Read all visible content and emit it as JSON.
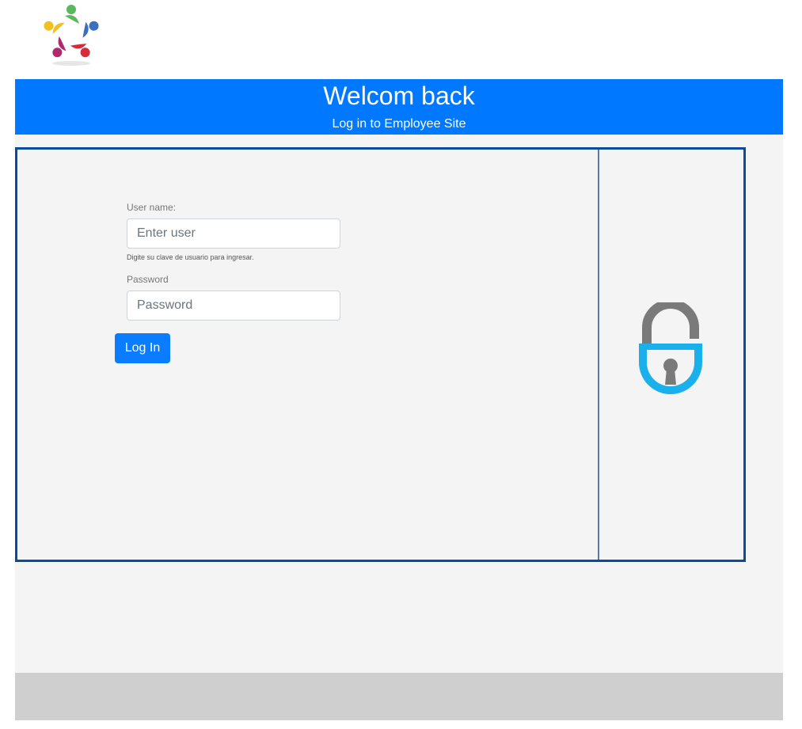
{
  "header": {
    "title": "Welcom back",
    "subtitle": "Log in to Employee Site",
    "logo_icon": "team-circle-logo-icon",
    "banner_color": "#0078ff"
  },
  "login_form": {
    "username_label": "User name:",
    "username_placeholder": "Enter user",
    "username_value": "",
    "username_help": "Digite su clave de usuario para ingresar.",
    "password_label": "Password",
    "password_placeholder": "Password",
    "password_value": "",
    "submit_label": "Log In",
    "button_color": "#0a7cff",
    "border_color": "#0a4c9a"
  },
  "side_panel": {
    "icon": "open-padlock-icon",
    "shackle_color": "#7a7a7a",
    "body_color": "#1ab0ec"
  },
  "footer": {
    "background": "#cfcfcf"
  }
}
